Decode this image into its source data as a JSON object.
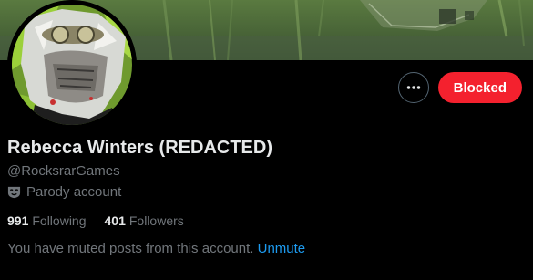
{
  "profile": {
    "display_name": "Rebecca Winters (REDACTED)",
    "handle": "@RocksrarGames",
    "parody_label": "Parody account",
    "following_count": "991",
    "following_label": "Following",
    "followers_count": "401",
    "followers_label": "Followers"
  },
  "actions": {
    "blocked_label": "Blocked"
  },
  "muted_notice": {
    "text": "You have muted posts from this account.",
    "unmute_label": "Unmute"
  },
  "colors": {
    "blocked_button": "#f4212e",
    "link": "#1d9bf0",
    "secondary_text": "#71767b"
  },
  "icons": {
    "more": "more-icon",
    "parody": "parody-mask-icon"
  }
}
